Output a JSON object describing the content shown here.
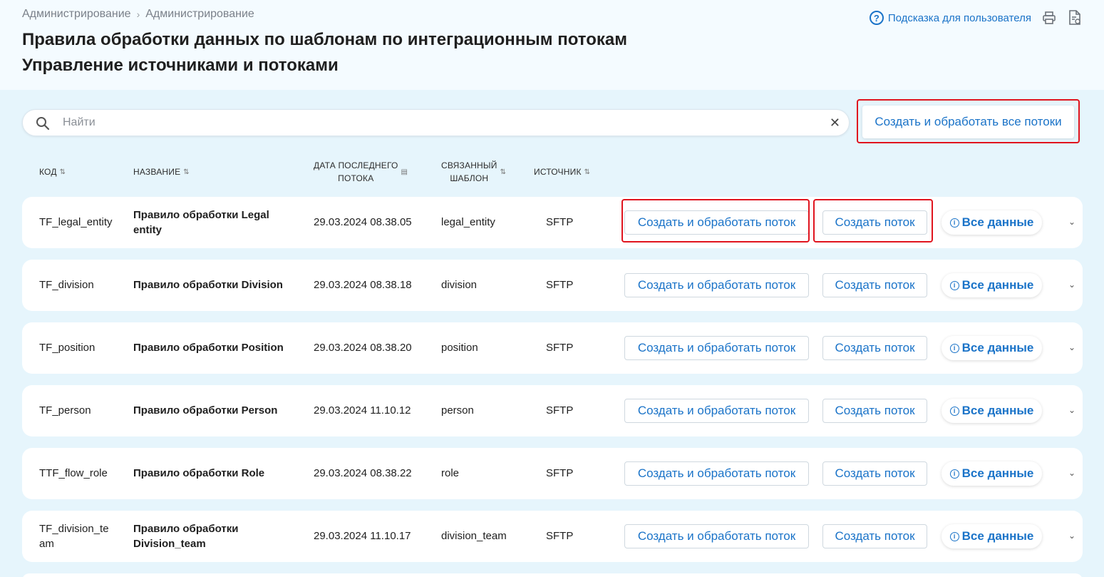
{
  "breadcrumb": [
    "Администрирование",
    "Администрирование"
  ],
  "page_title_line1": "Правила обработки данных по шаблонам по интеграционным потокам",
  "page_title_line2": "Управление источниками и потоками",
  "header": {
    "help_label": "Подсказка для пользователя"
  },
  "search": {
    "placeholder": "Найти",
    "value": ""
  },
  "all_button_label": "Создать и обработать все потоки",
  "columns": {
    "code": "КОД",
    "name": "НАЗВАНИЕ",
    "date_l1": "ДАТА ПОСЛЕДНЕГО",
    "date_l2": "ПОТОКА",
    "tpl_l1": "СВЯЗАННЫЙ",
    "tpl_l2": "ШАБЛОН",
    "source": "ИСТОЧНИК"
  },
  "row_buttons": {
    "process": "Создать и обработать поток",
    "create": "Создать поток",
    "all_data": "Все данные"
  },
  "rows": [
    {
      "code_l1": "TF_legal_entity",
      "code_l2": "",
      "name_l1": "Правило обработки Legal",
      "name_l2": "entity",
      "date": "29.03.2024 08.38.05",
      "template": "legal_entity",
      "source": "SFTP"
    },
    {
      "code_l1": "TF_division",
      "code_l2": "",
      "name_l1": "Правило обработки Division",
      "name_l2": "",
      "date": "29.03.2024 08.38.18",
      "template": "division",
      "source": "SFTP"
    },
    {
      "code_l1": "TF_position",
      "code_l2": "",
      "name_l1": "Правило обработки Position",
      "name_l2": "",
      "date": "29.03.2024 08.38.20",
      "template": "position",
      "source": "SFTP"
    },
    {
      "code_l1": "TF_person",
      "code_l2": "",
      "name_l1": "Правило обработки Person",
      "name_l2": "",
      "date": "29.03.2024 11.10.12",
      "template": "person",
      "source": "SFTP"
    },
    {
      "code_l1": "TTF_flow_role",
      "code_l2": "",
      "name_l1": "Правило обработки Role",
      "name_l2": "",
      "date": "29.03.2024 08.38.22",
      "template": "role",
      "source": "SFTP"
    },
    {
      "code_l1": "TF_division_te",
      "code_l2": "am",
      "name_l1": "Правило обработки",
      "name_l2": "Division_team",
      "date": "29.03.2024 11.10.17",
      "template": "division_team",
      "source": "SFTP"
    }
  ],
  "colors": {
    "accent": "#1a73c8",
    "highlight": "#e0141e",
    "background": "#e6f5fc"
  }
}
